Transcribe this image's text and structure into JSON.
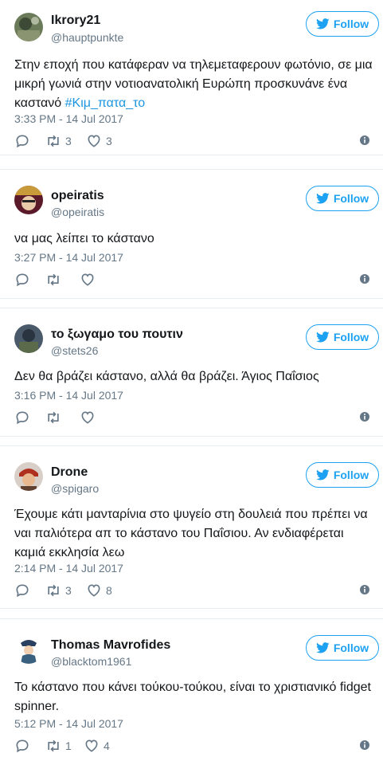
{
  "follow_label": "Follow",
  "tweets": [
    {
      "name": "Ikrory21",
      "handle": "@hauptpunkte",
      "text": "Στην εποχή που κατάφεραν να τηλεμεταφερουν φωτόνιο, σε μια μικρή γωνιά στην νοτιοανατολική Ευρώπη προσκυνάνε ένα καστανό ",
      "hashtag": "#Κιμ_πατα_το",
      "time": "3:33 PM - 14 Jul 2017",
      "retweets": "3",
      "likes": "3"
    },
    {
      "name": "opeiratis",
      "handle": "@opeiratis",
      "text": "να μας λείπει το κάστανο",
      "time": "3:27 PM - 14 Jul 2017",
      "retweets": "",
      "likes": ""
    },
    {
      "name": "το ξωγαμο του πουτιν",
      "handle": "@stets26",
      "text": "Δεν θα βράζει κάστανο, αλλά θα βράζει. Άγιος Παΐσιος",
      "time": "3:16 PM - 14 Jul 2017",
      "retweets": "",
      "likes": ""
    },
    {
      "name": "Drone",
      "handle": "@spigaro",
      "text": "Έχουμε κάτι μανταρίνια στο ψυγείο στη δουλειά που πρέπει να ναι παλιότερα απ το κάστανο του Παΐσιου. Αν ενδιαφέρεται καμιά εκκλησία λεω",
      "time": "2:14 PM - 14 Jul 2017",
      "retweets": "3",
      "likes": "8"
    },
    {
      "name": "Thomas Mavrofides",
      "handle": "@blacktom1961",
      "text": "Το κάστανο που κάνει τούκου-τούκου, είναι το χριστιανικό fidget spinner.",
      "time": "5:12 PM - 14 Jul 2017",
      "retweets": "1",
      "likes": "4"
    }
  ],
  "colors": {
    "accent": "#1da1f2",
    "hashtag": "#1b95e0",
    "muted": "#657786",
    "divider": "#e6ecf0"
  },
  "icons": [
    "twitter-bird-icon",
    "reply-icon",
    "retweet-icon",
    "like-icon",
    "info-icon"
  ]
}
